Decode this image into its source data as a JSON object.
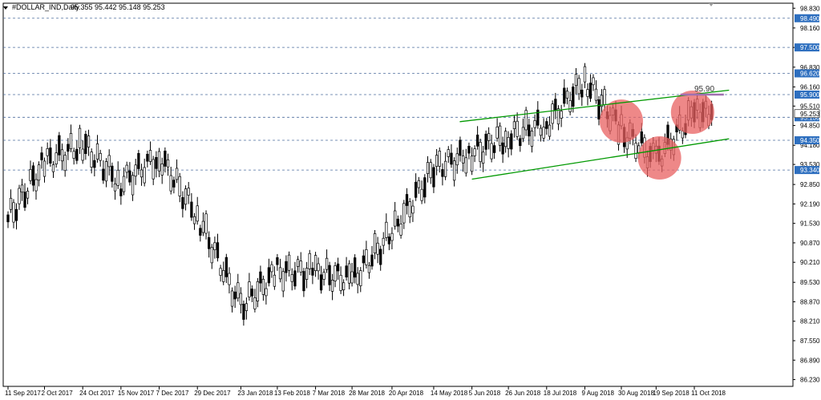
{
  "chart_data": {
    "type": "candlestick",
    "symbol_label": "#DOLLAR_IND,Daily",
    "ohlc_header": "95.355 95.442 95.148 95.253",
    "ylim": [
      86.0,
      99.0
    ],
    "y_ticks": [
      "98.830",
      "98.160",
      "97.500",
      "96.830",
      "96.160",
      "95.510",
      "94.850",
      "94.180",
      "93.530",
      "92.850",
      "92.190",
      "91.530",
      "90.870",
      "90.210",
      "89.530",
      "88.870",
      "88.210",
      "87.550",
      "86.890",
      "86.230"
    ],
    "price_labels": [
      {
        "text": "98.490",
        "value": 98.49
      },
      {
        "text": "97.500",
        "value": 97.5
      },
      {
        "text": "96.620",
        "value": 96.62
      },
      {
        "text": "95.900",
        "value": 95.9
      },
      {
        "text": "95.130",
        "value": 95.13
      },
      {
        "text": "94.350",
        "value": 94.35
      },
      {
        "text": "93.340",
        "value": 93.34
      }
    ],
    "current_price_label": "95.253",
    "x_ticks": [
      "11 Sep 2017",
      "2 Oct 2017",
      "24 Oct 2017",
      "15 Nov 2017",
      "7 Dec 2017",
      "29 Dec 2017",
      "23 Jan 2018",
      "13 Feb 2018",
      "7 Mar 2018",
      "28 Mar 2018",
      "20 Apr 2018",
      "14 May 2018",
      "5 Jun 2018",
      "26 Jun 2018",
      "18 Jul 2018",
      "9 Aug 2018",
      "30 Aug 2018",
      "19 Sep 2018",
      "11 Oct 2018"
    ],
    "trend_channel": {
      "upper": [
        {
          "date": "29 May 2018",
          "price": 94.98
        },
        {
          "date": "31 Oct 2018",
          "price": 96.05
        }
      ],
      "lower": [
        {
          "date": "5 Jun 2018",
          "price": 93.03
        },
        {
          "date": "31 Oct 2018",
          "price": 94.4
        }
      ]
    },
    "horizontal_level": {
      "label": "95.90",
      "value": 95.9
    },
    "highlight_zones": [
      {
        "date": "30 Aug 2018",
        "price": 95.0
      },
      {
        "date": "21 Sep 2018",
        "price": 93.75
      },
      {
        "date": "10 Oct 2018",
        "price": 95.3
      }
    ],
    "candles": [
      {
        "date": "11 Sep 2017",
        "o": 91.4,
        "h": 92.0,
        "l": 91.0,
        "c": 91.7
      },
      {
        "date": "2 Oct 2017",
        "o": 92.4,
        "h": 93.9,
        "l": 92.1,
        "c": 93.6
      },
      {
        "date": "24 Oct 2017",
        "o": 94.4,
        "h": 95.0,
        "l": 93.8,
        "c": 94.2
      },
      {
        "date": "15 Nov 2017",
        "o": 93.2,
        "h": 93.6,
        "l": 92.5,
        "c": 92.9
      },
      {
        "date": "7 Dec 2017",
        "o": 93.6,
        "h": 94.2,
        "l": 93.2,
        "c": 93.8
      },
      {
        "date": "29 Dec 2017",
        "o": 92.0,
        "h": 92.4,
        "l": 91.5,
        "c": 91.8
      },
      {
        "date": "23 Jan 2018",
        "o": 89.0,
        "h": 89.4,
        "l": 88.3,
        "c": 88.7
      },
      {
        "date": "13 Feb 2018",
        "o": 89.5,
        "h": 90.1,
        "l": 88.3,
        "c": 89.9
      },
      {
        "date": "7 Mar 2018",
        "o": 89.8,
        "h": 90.4,
        "l": 89.3,
        "c": 89.9
      },
      {
        "date": "28 Mar 2018",
        "o": 89.8,
        "h": 90.2,
        "l": 89.0,
        "c": 89.6
      },
      {
        "date": "20 Apr 2018",
        "o": 90.6,
        "h": 91.4,
        "l": 90.3,
        "c": 91.2
      },
      {
        "date": "14 May 2018",
        "o": 93.0,
        "h": 93.6,
        "l": 92.8,
        "c": 93.4
      },
      {
        "date": "5 Jun 2018",
        "o": 93.8,
        "h": 94.3,
        "l": 93.0,
        "c": 93.9
      },
      {
        "date": "26 Jun 2018",
        "o": 94.7,
        "h": 95.2,
        "l": 94.2,
        "c": 94.5
      },
      {
        "date": "18 Jul 2018",
        "o": 94.6,
        "h": 95.3,
        "l": 94.1,
        "c": 94.9
      },
      {
        "date": "9 Aug 2018",
        "o": 95.8,
        "h": 96.9,
        "l": 95.4,
        "c": 96.4
      },
      {
        "date": "30 Aug 2018",
        "o": 95.1,
        "h": 95.4,
        "l": 94.4,
        "c": 94.7
      },
      {
        "date": "19 Sep 2018",
        "o": 94.0,
        "h": 94.2,
        "l": 93.3,
        "c": 93.7
      },
      {
        "date": "11 Oct 2018",
        "o": 95.4,
        "h": 95.8,
        "l": 94.9,
        "c": 95.3
      }
    ]
  },
  "colors": {
    "background": "#ffffff",
    "grid": "#4f6f9f",
    "candle": "#000000",
    "channel": "#009900",
    "price_label_bg": "#2e6fbf",
    "current_label_bg": "#ffffff",
    "highlight": "#e86060",
    "level_line": "#a070b0"
  },
  "icons": {
    "menu": "triangle-down-icon",
    "scroll": "scroll-arrow-icon"
  }
}
